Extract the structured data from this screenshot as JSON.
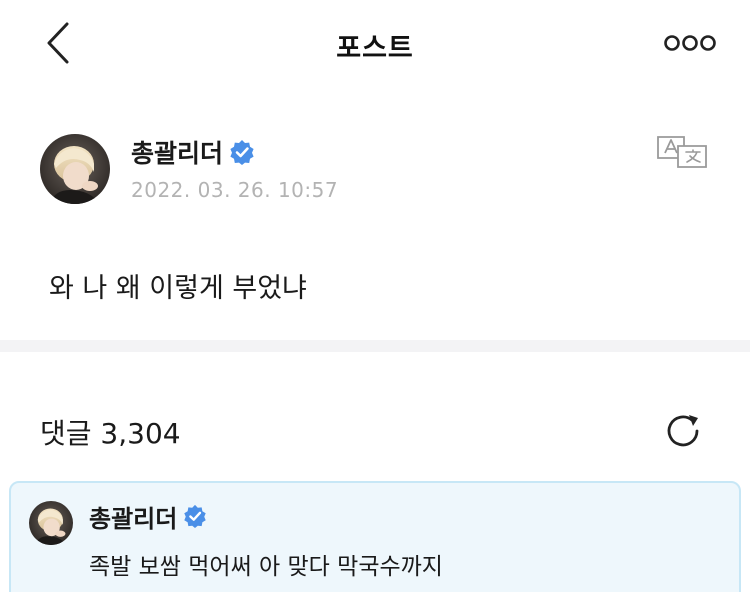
{
  "header": {
    "title": "포스트",
    "back_icon": "chevron-left-icon",
    "more_icon": "more-horizontal-icon"
  },
  "post": {
    "author": "총괄리더",
    "verified_icon": "verified-badge-icon",
    "timestamp": "2022. 03. 26. 10:57",
    "translate_icon": "translate-icon",
    "body": "와 나 왜 이렇게 부었냐"
  },
  "comments": {
    "label": "댓글 3,304",
    "refresh_icon": "refresh-icon",
    "pinned": {
      "author": "총괄리더",
      "text": "족발 보쌈 먹어써 아 맞다 막국수까지"
    }
  },
  "colors": {
    "verified": "#4a8fe7",
    "timestamp": "#b3b3b3",
    "pinned_bg": "#eef7fc",
    "pinned_border": "#c7e7f6"
  }
}
